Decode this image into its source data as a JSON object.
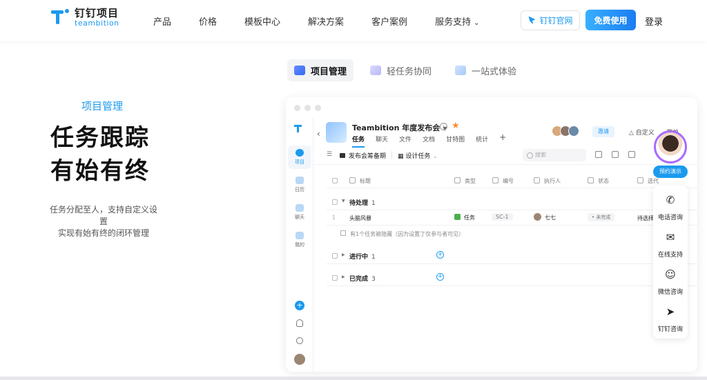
{
  "brand": {
    "name": "钉钉项目",
    "sub": "teambition"
  },
  "nav": {
    "items": [
      "产品",
      "价格",
      "模板中心",
      "解决方案",
      "客户案例",
      "服务支持"
    ]
  },
  "actions": {
    "dingding": "钉钉官网",
    "free": "免费使用",
    "login": "登录"
  },
  "hero": {
    "tag": "项目管理",
    "title_line1": "任务跟踪",
    "title_line2": "有始有终",
    "sub_line1": "任务分配至人，支持自定义设置",
    "sub_line2": "实现有始有终的闭环管理"
  },
  "feature_tabs": [
    "项目管理",
    "轻任务协同",
    "一站式体验"
  ],
  "app": {
    "sidebar": {
      "items": [
        "项目",
        "日历",
        "聊天",
        "我的"
      ]
    },
    "project": {
      "name": "Teambition 年度发布会",
      "tabs": [
        "任务",
        "聊天",
        "文件",
        "文档",
        "甘特图",
        "统计"
      ],
      "invite": "邀请",
      "custom": "自定义",
      "menu": "菜单"
    },
    "toolbar": {
      "stage": "发布会筹备期",
      "view": "设计任务",
      "search_placeholder": "搜索"
    },
    "columns": [
      "标题",
      "类型",
      "编号",
      "执行人",
      "状态",
      "选代"
    ],
    "groups": [
      {
        "name": "待处理",
        "count": "1"
      },
      {
        "name": "进行中",
        "count": "1"
      },
      {
        "name": "已完成",
        "count": "3"
      }
    ],
    "task": {
      "num": "1",
      "name": "头脑风暴",
      "type": "任务",
      "code": "SC-1",
      "assignee": "七七",
      "status": "• 未完成",
      "iteration": "待选择"
    },
    "hidden_note": "有1个任务被隐藏（因为设置了仅参与者可见）"
  },
  "float_panel": {
    "demo": "预约演示",
    "items": [
      "电话咨询",
      "在线支持",
      "微信咨询",
      "钉钉咨询"
    ]
  }
}
